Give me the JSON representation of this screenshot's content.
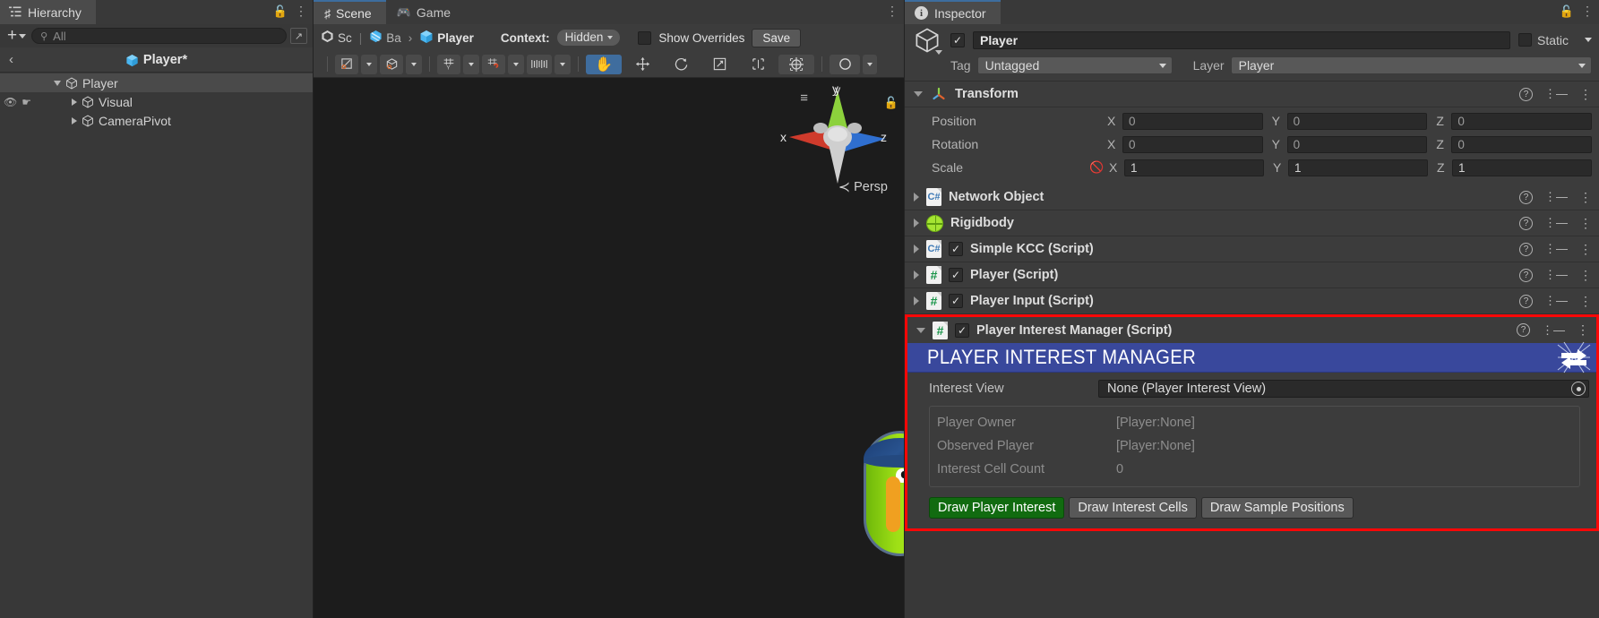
{
  "hierarchy": {
    "tab_label": "Hierarchy",
    "tab_icon": "hierarchy-icon",
    "add_label": "+",
    "search_placeholder": "All",
    "breadcrumb_title": "Player*",
    "tree": [
      {
        "label": "Player",
        "depth": 0,
        "expanded": true,
        "selected": true,
        "has_visibility": false
      },
      {
        "label": "Visual",
        "depth": 1,
        "expanded": false,
        "selected": false,
        "has_visibility": true
      },
      {
        "label": "CameraPivot",
        "depth": 1,
        "expanded": false,
        "selected": false,
        "has_visibility": false
      }
    ]
  },
  "scene": {
    "tabs": [
      {
        "label": "Scene",
        "icon": "grid-icon",
        "active": true
      },
      {
        "label": "Game",
        "icon": "gamepad-icon",
        "active": false
      }
    ],
    "breadcrumb": [
      {
        "label": "Sc",
        "icon": "unity-icon"
      },
      {
        "label": "Ba",
        "icon": "prefab-icon"
      },
      {
        "label": "Player",
        "icon": "cube-icon"
      }
    ],
    "context_label": "Context:",
    "context_value": "Hidden",
    "show_overrides_label": "Show Overrides",
    "save_label": "Save",
    "toolbar_tools": [
      "draw-mode-icon",
      "shading-mode-icon",
      "grid-snap-icon",
      "magnet-snap-icon",
      "scale-handle-icon",
      "hand-tool-icon",
      "move-tool-icon",
      "rotate-tool-icon",
      "scale-tool-icon",
      "rect-tool-icon",
      "transform-tool-icon",
      "lighting-icon"
    ],
    "gizmo": {
      "axis_y": "y",
      "axis_x": "x",
      "axis_z": "z",
      "projection": "Persp"
    }
  },
  "inspector": {
    "tab_label": "Inspector",
    "tab_icon": "info-icon",
    "game_object": {
      "enabled": true,
      "name": "Player",
      "static_label": "Static",
      "static_checked": false,
      "tag_label": "Tag",
      "tag_value": "Untagged",
      "layer_label": "Layer",
      "layer_value": "Player"
    },
    "transform": {
      "title": "Transform",
      "expanded": true,
      "rows": [
        {
          "label": "Position",
          "x": "0",
          "y": "0",
          "z": "0",
          "dim": true,
          "has_link": false
        },
        {
          "label": "Rotation",
          "x": "0",
          "y": "0",
          "z": "0",
          "dim": true,
          "has_link": false
        },
        {
          "label": "Scale",
          "x": "1",
          "y": "1",
          "z": "1",
          "dim": false,
          "has_link": true
        }
      ],
      "axis_labels": {
        "x": "X",
        "y": "Y",
        "z": "Z"
      }
    },
    "components": [
      {
        "title": "Network Object",
        "icon": "csharp-script-icon",
        "has_checkbox": false,
        "expanded": false
      },
      {
        "title": "Rigidbody",
        "icon": "rigidbody-icon",
        "has_checkbox": false,
        "expanded": false
      },
      {
        "title": "Simple KCC (Script)",
        "icon": "csharp-script-icon",
        "has_checkbox": true,
        "checked": true,
        "expanded": false
      },
      {
        "title": "Player (Script)",
        "icon": "hash-script-icon",
        "has_checkbox": true,
        "checked": true,
        "expanded": false
      },
      {
        "title": "Player Input (Script)",
        "icon": "hash-script-icon",
        "has_checkbox": true,
        "checked": true,
        "expanded": false
      }
    ],
    "highlighted_component": {
      "title": "Player Interest Manager (Script)",
      "icon": "hash-script-icon",
      "checked": true,
      "expanded": true,
      "highlight_color": "#fb0707",
      "banner": {
        "title": "PLAYER INTEREST MANAGER",
        "color": "#39489c",
        "logo": "exchange-arrows-icon"
      },
      "fields": [
        {
          "label": "Interest View",
          "value": "None (Player Interest View)",
          "type": "object-field"
        }
      ],
      "readonly_rows": [
        {
          "label": "Player Owner",
          "value": "[Player:None]"
        },
        {
          "label": "Observed Player",
          "value": "[Player:None]"
        },
        {
          "label": "Interest Cell Count",
          "value": "0"
        }
      ],
      "buttons": [
        {
          "label": "Draw Player Interest",
          "active": true
        },
        {
          "label": "Draw Interest Cells",
          "active": false
        },
        {
          "label": "Draw Sample Positions",
          "active": false
        }
      ]
    },
    "row_icons": {
      "help": "?",
      "preset": "preset-icon",
      "menu": "kebab-menu-icon"
    }
  }
}
